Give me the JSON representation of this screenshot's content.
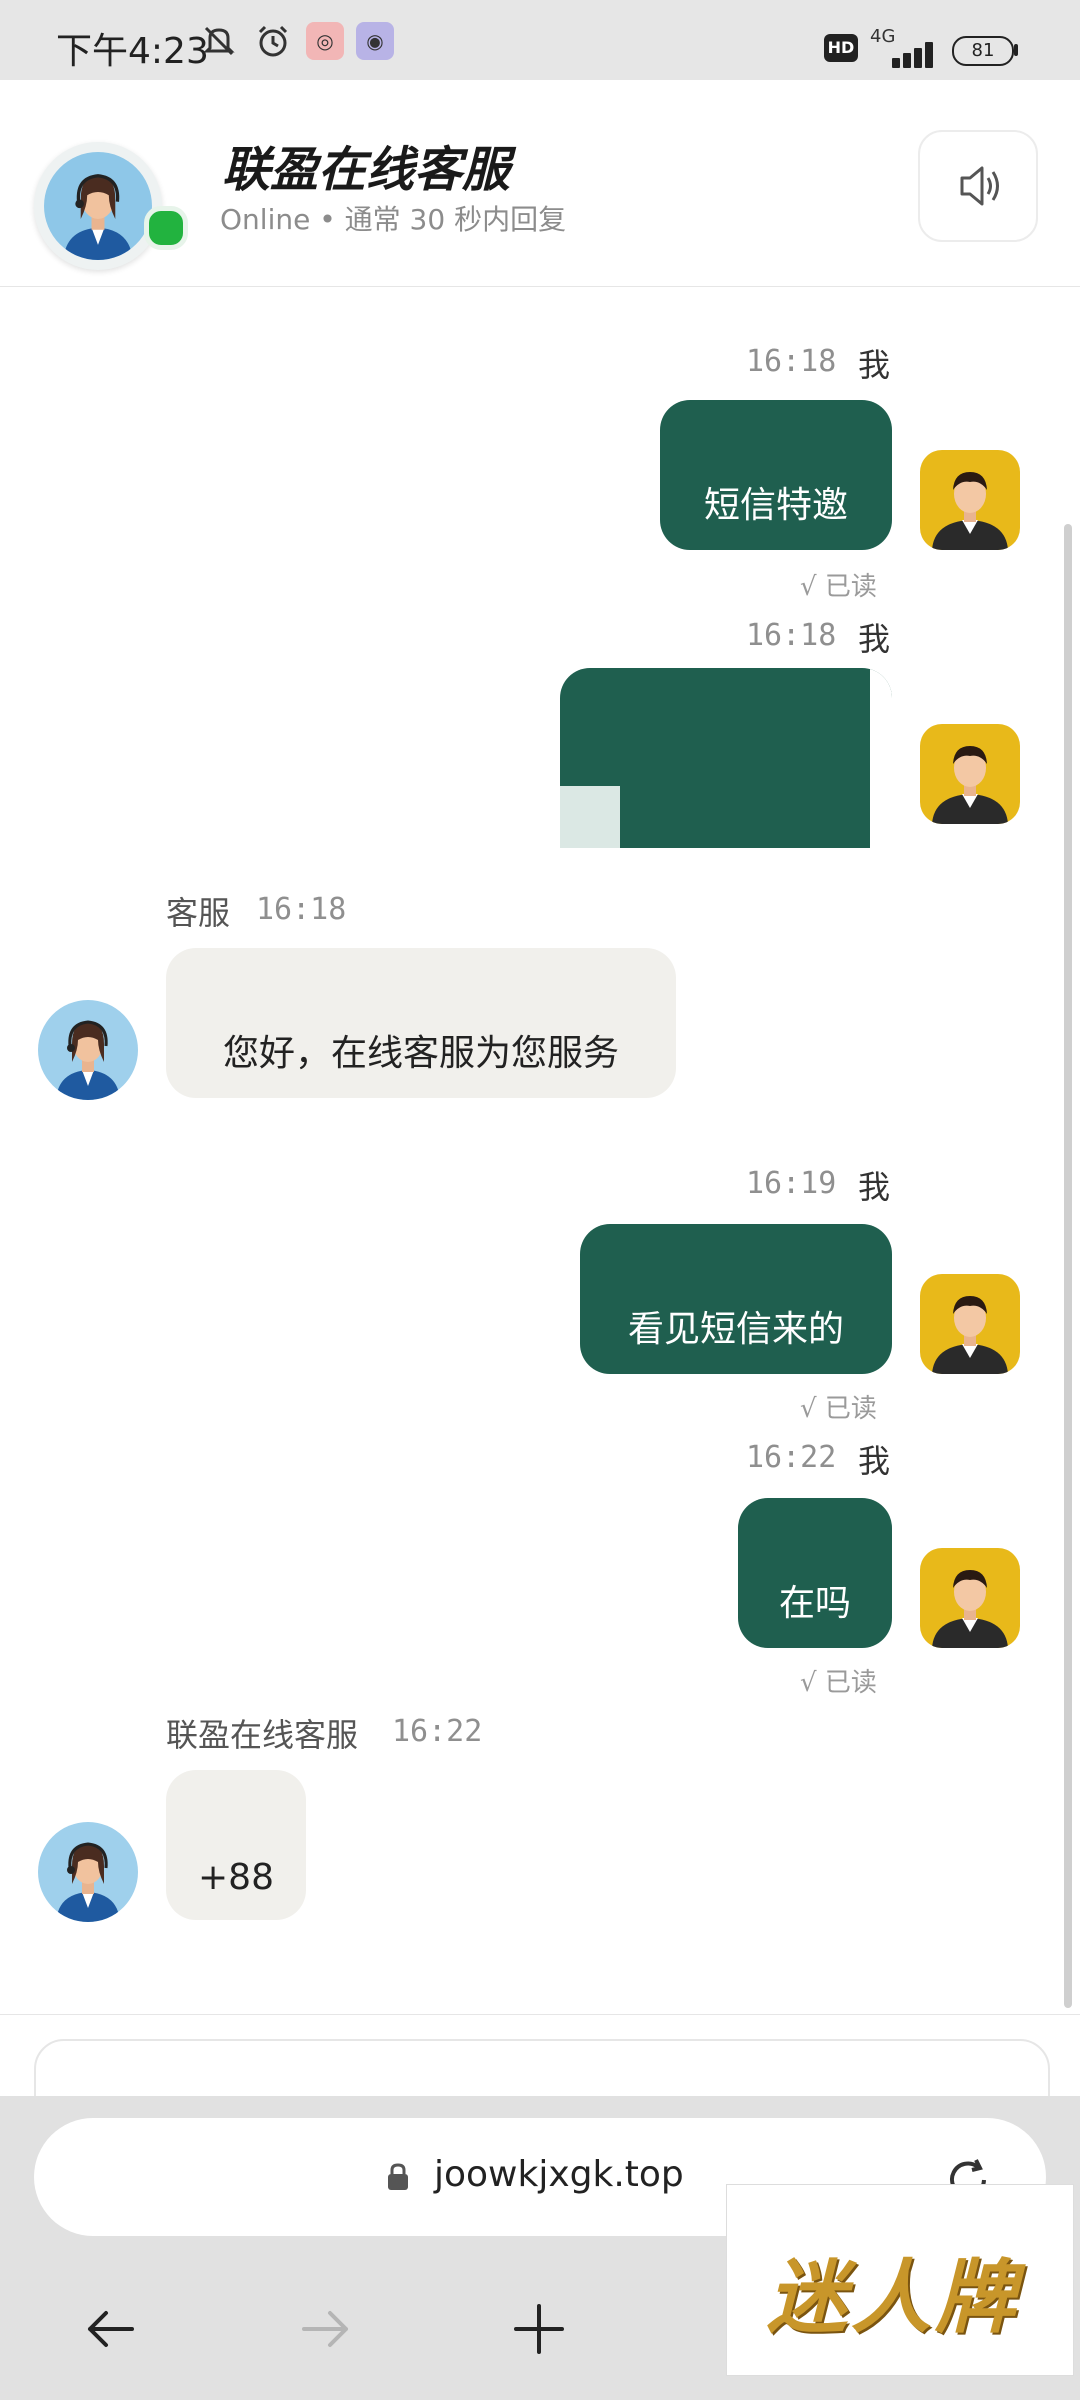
{
  "status_bar": {
    "time": "下午4:23",
    "network": "4G",
    "hd": "HD",
    "battery": "81"
  },
  "header": {
    "title": "联盈在线客服",
    "subtitle": "Online • 通常 30 秒内回复"
  },
  "messages": [
    {
      "sender": "me",
      "sender_label": "我",
      "time": "16:18",
      "text": "短信特邀",
      "read": "√ 已读"
    },
    {
      "sender": "me",
      "sender_label": "我",
      "time": "16:18",
      "type": "image"
    },
    {
      "sender": "agent",
      "sender_label": "客服",
      "time": "16:18",
      "text": "您好，在线客服为您服务"
    },
    {
      "sender": "me",
      "sender_label": "我",
      "time": "16:19",
      "text": "看见短信来的",
      "read": "√ 已读"
    },
    {
      "sender": "me",
      "sender_label": "我",
      "time": "16:22",
      "text": "在吗",
      "read": "√ 已读"
    },
    {
      "sender": "agent",
      "sender_label": "联盈在线客服",
      "time": "16:22",
      "text": "+88"
    }
  ],
  "browser": {
    "url": "joowkjxgk.top"
  },
  "overlay": {
    "watermark_text": "迷人牌"
  },
  "colors": {
    "outgoing_bubble": "#1f5f4f",
    "incoming_bubble": "#f1f0ec",
    "online_dot": "#22b33f"
  },
  "icons": [
    "back-icon",
    "speaker-icon",
    "lock-icon",
    "reload-icon",
    "arrow-left-icon",
    "arrow-right-icon",
    "plus-icon",
    "mute-bell-icon",
    "alarm-icon",
    "signal-icon",
    "battery-icon"
  ]
}
